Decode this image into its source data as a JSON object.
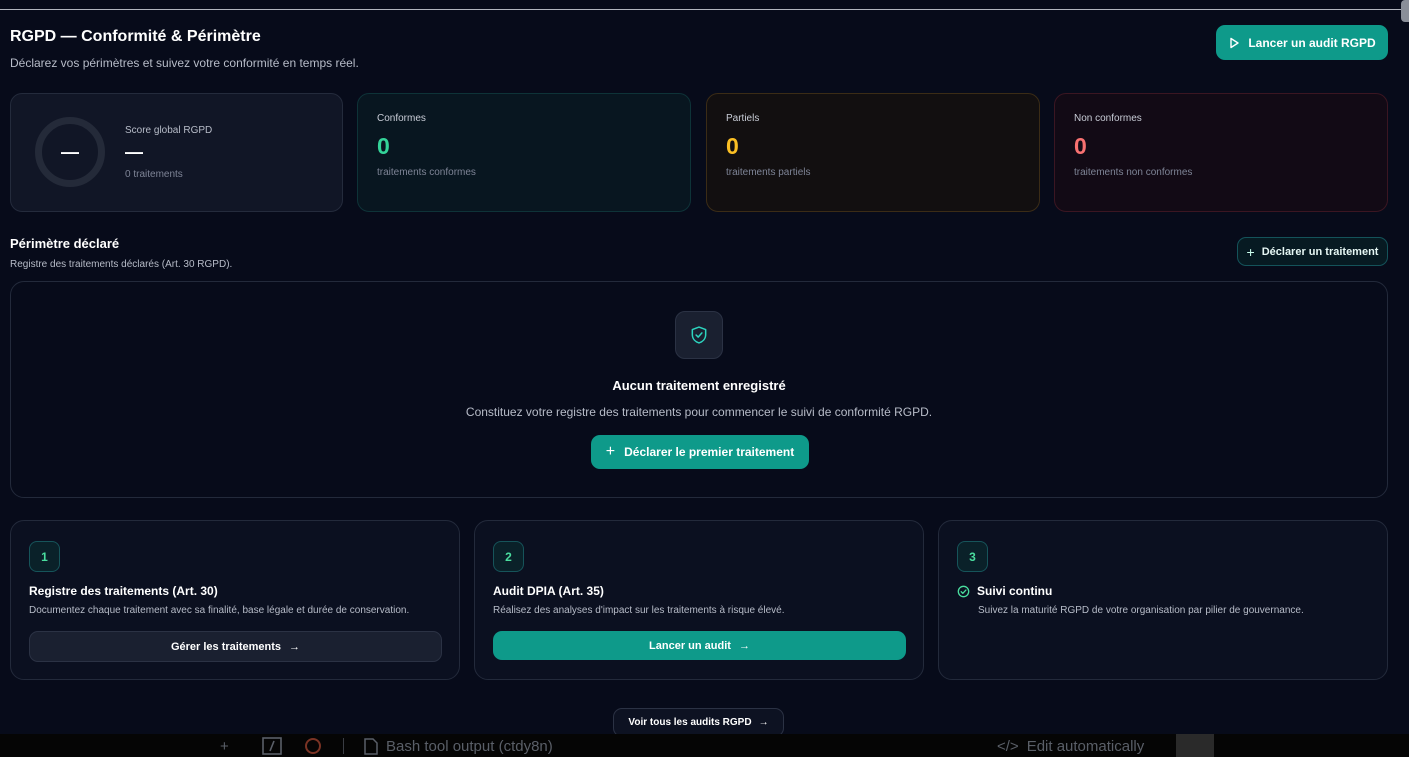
{
  "header": {
    "title": "RGPD — Conformité & Périmètre",
    "subtitle": "Déclarez vos périmètres et suivez votre conformité en temps réel.",
    "audit_button": "Lancer un audit RGPD"
  },
  "score": {
    "ring_value": "—",
    "label": "Score global RGPD",
    "value": "—",
    "count": "0 traitements"
  },
  "stats": {
    "conformes": {
      "label": "Conformes",
      "value": "0",
      "desc": "traitements conformes"
    },
    "partiels": {
      "label": "Partiels",
      "value": "0",
      "desc": "traitements partiels"
    },
    "non_conformes": {
      "label": "Non conformes",
      "value": "0",
      "desc": "traitements non conformes"
    }
  },
  "perimetre": {
    "title": "Périmètre déclaré",
    "subtitle": "Registre des traitements déclarés (Art. 30 RGPD).",
    "declare_button": "Déclarer un traitement"
  },
  "empty_state": {
    "title": "Aucun traitement enregistré",
    "description": "Constituez votre registre des traitements pour commencer le suivi de conformité RGPD.",
    "cta": "Déclarer le premier traitement"
  },
  "steps": [
    {
      "num": "1",
      "title": "Registre des traitements (Art. 30)",
      "desc": "Documentez chaque traitement avec sa finalité, base légale et durée de conservation.",
      "button": "Gérer les traitements"
    },
    {
      "num": "2",
      "title": "Audit DPIA (Art. 35)",
      "desc": "Réalisez des analyses d'impact sur les traitements à risque élevé.",
      "button": "Lancer un audit"
    },
    {
      "num": "3",
      "title": "Suivi continu",
      "desc": "Suivez la maturité RGPD de votre organisation par pilier de gouvernance."
    }
  ],
  "footer_button": "Voir tous les audits RGPD",
  "bottombar": {
    "output_label": "Bash tool output (ctdy8n)",
    "edit_label": "Edit automatically"
  },
  "colors": {
    "accent": "#0e9a8a",
    "conformes": "#34d399",
    "partiels": "#fbbf24",
    "non_conformes": "#f87171"
  }
}
